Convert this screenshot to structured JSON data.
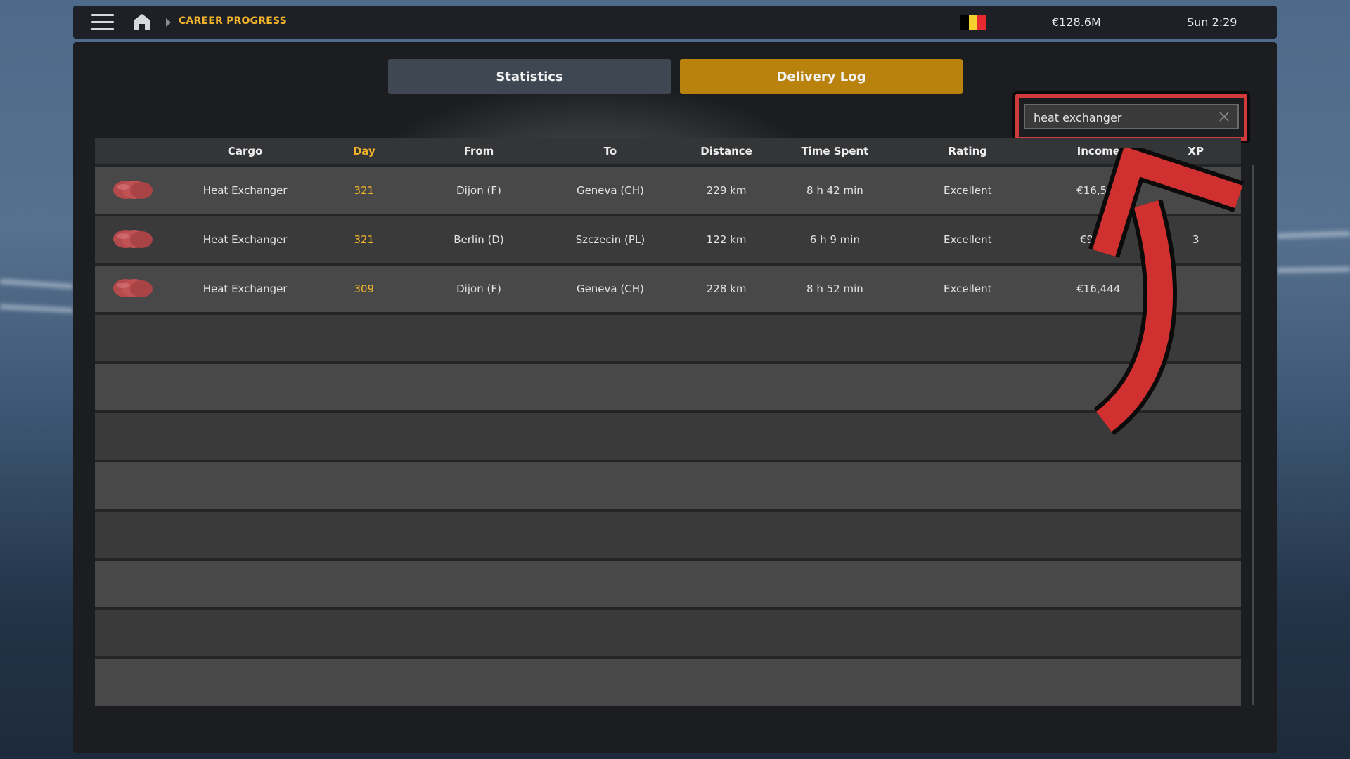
{
  "topbar": {
    "menu_icon": "hamburger-menu-icon",
    "home_icon": "home-icon",
    "breadcrumb_separator_icon": "chevron-right-icon",
    "breadcrumb": "CAREER PROGRESS",
    "flag": {
      "country": "Belgium",
      "colors": [
        "#000000",
        "#f5cf2c",
        "#e52b2f"
      ]
    },
    "balance": "€128.6M",
    "clock": "Sun 2:29"
  },
  "tabs": [
    {
      "label": "Statistics",
      "active": false
    },
    {
      "label": "Delivery Log",
      "active": true
    }
  ],
  "search": {
    "value": "heat exchanger",
    "clear_icon": "close-icon"
  },
  "table": {
    "columns": [
      "",
      "Cargo",
      "Day",
      "From",
      "To",
      "Distance",
      "Time Spent",
      "Rating",
      "Income",
      "XP"
    ],
    "sorted_column": "Day",
    "rows": [
      {
        "cargo_icon": "heat-exchanger-cargo-icon",
        "cargo": "Heat Exchanger",
        "day": "321",
        "from": "Dijon (F)",
        "to": "Geneva (CH)",
        "distance": "229 km",
        "time_spent": "8 h 42 min",
        "rating": "Excellent",
        "income": "€16,568",
        "xp": ""
      },
      {
        "cargo_icon": "heat-exchanger-cargo-icon",
        "cargo": "Heat Exchanger",
        "day": "321",
        "from": "Berlin (D)",
        "to": "Szczecin (PL)",
        "distance": "122 km",
        "time_spent": "6 h 9 min",
        "rating": "Excellent",
        "income": "€9,179",
        "xp": "3"
      },
      {
        "cargo_icon": "heat-exchanger-cargo-icon",
        "cargo": "Heat Exchanger",
        "day": "309",
        "from": "Dijon (F)",
        "to": "Geneva (CH)",
        "distance": "228 km",
        "time_spent": "8 h 52 min",
        "rating": "Excellent",
        "income": "€16,444",
        "xp": ""
      }
    ],
    "empty_rows": 8
  },
  "annotation": {
    "type": "curved-arrow",
    "color": "#d0302f",
    "points_to": "search-field"
  },
  "colors": {
    "accent": "#f0b32a",
    "active_tab": "#b8820c",
    "inactive_tab": "#3f4852",
    "highlight": "#cf3a3a"
  }
}
